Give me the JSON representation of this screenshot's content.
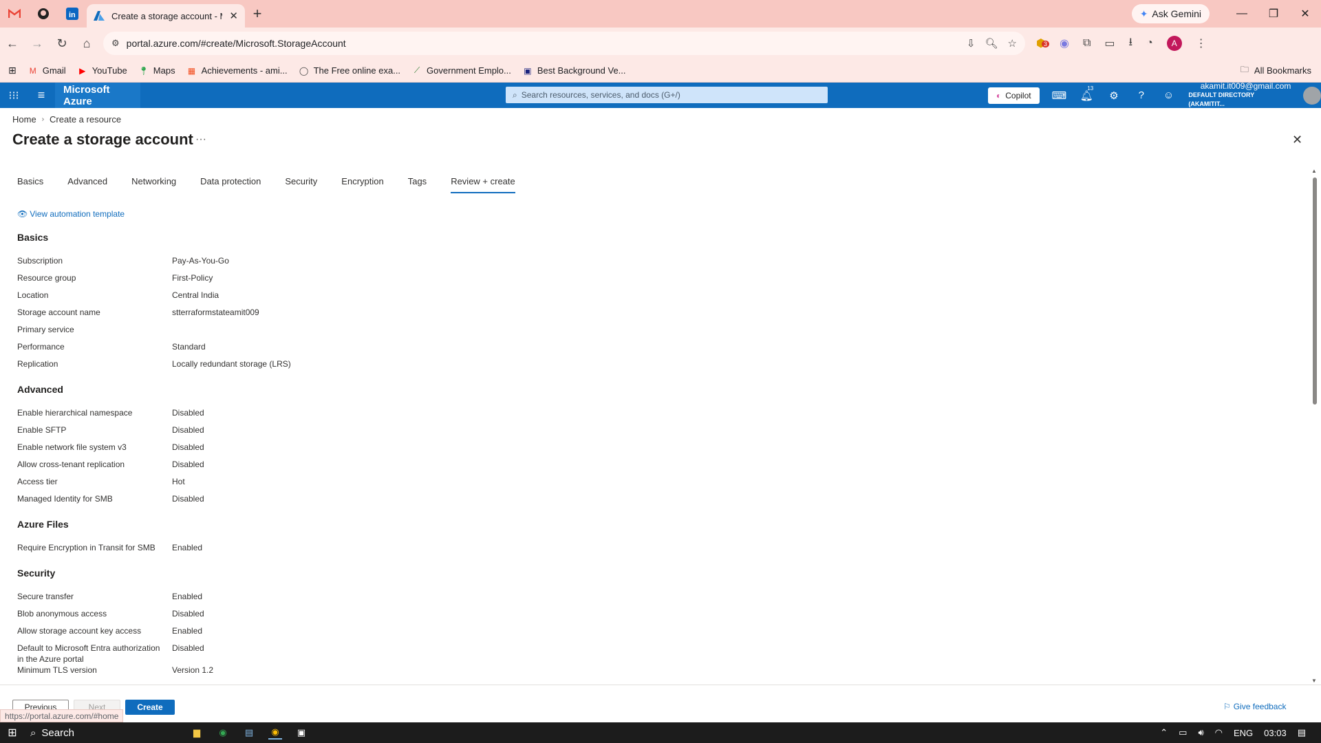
{
  "browser": {
    "pinned_tabs": [
      "gmail-icon",
      "github-icon",
      "linkedin-icon"
    ],
    "active_tab_title": "Create a storage account - Micr",
    "ask_gemini": "Ask Gemini",
    "url": "portal.azure.com/#create/Microsoft.StorageAccount",
    "bookmarks": [
      {
        "label": "Gmail",
        "icon": "gmail-icon"
      },
      {
        "label": "YouTube",
        "icon": "youtube-icon"
      },
      {
        "label": "Maps",
        "icon": "maps-icon"
      },
      {
        "label": "Achievements - ami...",
        "icon": "microsoft-icon"
      },
      {
        "label": "The Free online exa...",
        "icon": "globe-icon"
      },
      {
        "label": "Government Emplo...",
        "icon": "govt-icon"
      },
      {
        "label": "Best Background Ve...",
        "icon": "bg-icon"
      }
    ],
    "all_bookmarks": "All Bookmarks",
    "extension_badge": "3",
    "profile_initial": "A",
    "status_url": "https://portal.azure.com/#home"
  },
  "azure": {
    "brand": "Microsoft Azure",
    "search_placeholder": "Search resources, services, and docs (G+/)",
    "copilot": "Copilot",
    "notification_count": "13",
    "user_email": "akamit.it009@gmail.com",
    "user_directory": "DEFAULT DIRECTORY (AKAMITIT..."
  },
  "page": {
    "breadcrumb": [
      "Home",
      "Create a resource"
    ],
    "title": "Create a storage account",
    "tabs": [
      "Basics",
      "Advanced",
      "Networking",
      "Data protection",
      "Security",
      "Encryption",
      "Tags",
      "Review + create"
    ],
    "selected_tab": "Review + create",
    "automation_link": "View automation template"
  },
  "sections": [
    {
      "heading": "Basics",
      "rows": [
        {
          "label": "Subscription",
          "value": "Pay-As-You-Go"
        },
        {
          "label": "Resource group",
          "value": "First-Policy"
        },
        {
          "label": "Location",
          "value": "Central India"
        },
        {
          "label": "Storage account name",
          "value": "stterraformstateamit009"
        },
        {
          "label": "Primary service",
          "value": ""
        },
        {
          "label": "Performance",
          "value": "Standard"
        },
        {
          "label": "Replication",
          "value": "Locally redundant storage (LRS)"
        }
      ]
    },
    {
      "heading": "Advanced",
      "rows": [
        {
          "label": "Enable hierarchical namespace",
          "value": "Disabled"
        },
        {
          "label": "Enable SFTP",
          "value": "Disabled"
        },
        {
          "label": "Enable network file system v3",
          "value": "Disabled"
        },
        {
          "label": "Allow cross-tenant replication",
          "value": "Disabled"
        },
        {
          "label": "Access tier",
          "value": "Hot"
        },
        {
          "label": "Managed Identity for SMB",
          "value": "Disabled"
        }
      ]
    },
    {
      "heading": "Azure Files",
      "rows": [
        {
          "label": "Require Encryption in Transit for SMB",
          "value": "Enabled"
        }
      ]
    },
    {
      "heading": "Security",
      "rows": [
        {
          "label": "Secure transfer",
          "value": "Enabled"
        },
        {
          "label": "Blob anonymous access",
          "value": "Disabled"
        },
        {
          "label": "Allow storage account key access",
          "value": "Enabled"
        },
        {
          "label": "Default to Microsoft Entra authorization in the Azure portal",
          "value": "Disabled"
        },
        {
          "label": "Minimum TLS version",
          "value": "Version 1.2"
        }
      ]
    }
  ],
  "footer": {
    "previous": "Previous",
    "next": "Next",
    "create": "Create",
    "feedback": "Give feedback"
  },
  "taskbar": {
    "search": "Search",
    "lang": "ENG",
    "time": "03:03"
  },
  "colors": {
    "azure_blue": "#0f6cbd",
    "chrome_tab": "#f8c8c2"
  }
}
